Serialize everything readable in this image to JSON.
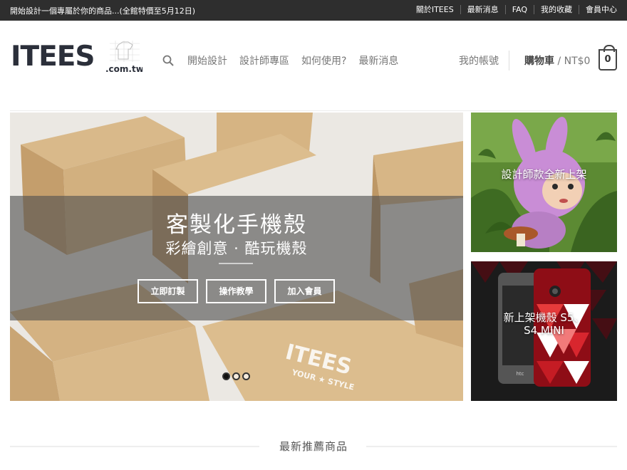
{
  "topbar": {
    "promo": "開始設計一個專屬於你的商品...(全館特價至5月12日)",
    "links": [
      "關於ITEES",
      "最新消息",
      "FAQ",
      "我的收藏",
      "會員中心"
    ]
  },
  "header": {
    "logo_main": "ITEES",
    "logo_suffix": ".com.tw",
    "nav": [
      "開始設計",
      "設計師專區",
      "如何使用?",
      "最新消息"
    ],
    "account": "我的帳號",
    "cart_label": "購物車",
    "cart_total": " / NT$0",
    "cart_count": "0"
  },
  "hero": {
    "title": "客製化手機殼",
    "subtitle": "彩繪創意 · 酷玩機殼",
    "buttons": [
      "立即訂製",
      "操作教學",
      "加入會員"
    ],
    "slides": 3,
    "active_slide": 1,
    "box_print": "ITEES",
    "box_print_sub": "YOUR ★ STYLE"
  },
  "banners": [
    {
      "label": "設計師款全新上架"
    },
    {
      "label_line1": "新上架機殼 S5、",
      "label_line2": "S4 MINI",
      "phone_brand": "htc"
    }
  ],
  "section": {
    "heading": "最新推薦商品"
  },
  "colors": {
    "topbar": "#2e2e2e",
    "text": "#777777",
    "accent": "#444444"
  }
}
